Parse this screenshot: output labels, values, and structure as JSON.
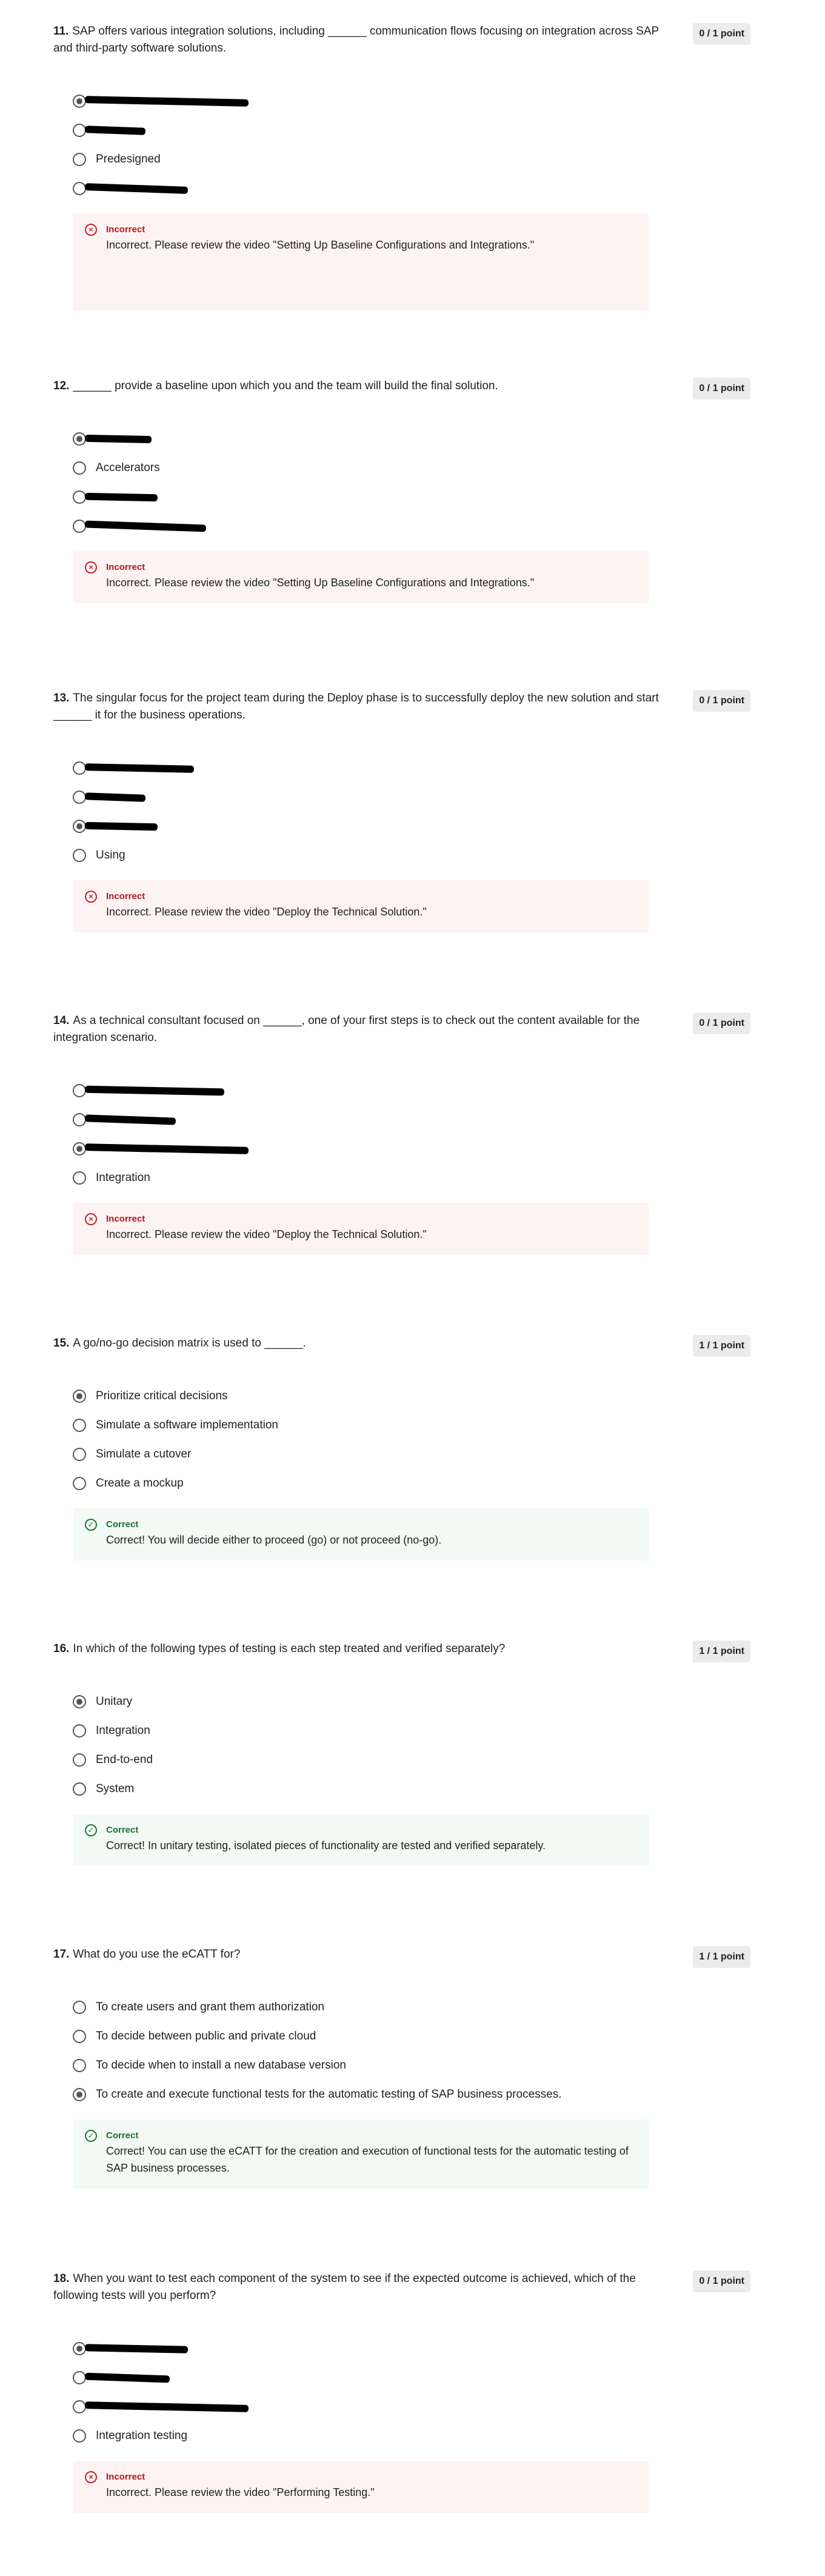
{
  "questions": [
    {
      "number": "11.",
      "text": "SAP offers various integration solutions, including ______ communication flows focusing on integration across SAP and third-party software solutions.",
      "points": "0 / 1 point",
      "options": [
        {
          "label": "",
          "selected": true,
          "redacted": 270
        },
        {
          "label": "",
          "selected": false,
          "redacted": 100
        },
        {
          "label": "Predesigned",
          "selected": false,
          "redacted": 0
        },
        {
          "label": "",
          "selected": false,
          "redacted": 170
        }
      ],
      "feedback": {
        "status": "incorrect",
        "title": "Incorrect",
        "icon": "close-icon",
        "text": "Incorrect. Please review the video \"Setting Up Baseline Configurations and Integrations.\""
      }
    },
    {
      "number": "12.",
      "text": "______ provide a baseline upon which you and the team will build the final solution.",
      "points": "0 / 1 point",
      "options": [
        {
          "label": "",
          "selected": true,
          "redacted": 110
        },
        {
          "label": "Accelerators",
          "selected": false,
          "redacted": 0
        },
        {
          "label": "",
          "selected": false,
          "redacted": 120
        },
        {
          "label": "",
          "selected": false,
          "redacted": 200
        }
      ],
      "feedback": {
        "status": "incorrect",
        "title": "Incorrect",
        "icon": "close-icon",
        "text": "Incorrect. Please review the video \"Setting Up Baseline Configurations and Integrations.\""
      }
    },
    {
      "number": "13.",
      "text": "The singular focus for the project team during the Deploy phase is to successfully deploy the new solution and start ______ it for the business operations.",
      "points": "0 / 1 point",
      "options": [
        {
          "label": "",
          "selected": false,
          "redacted": 180
        },
        {
          "label": "",
          "selected": false,
          "redacted": 100
        },
        {
          "label": "",
          "selected": true,
          "redacted": 120
        },
        {
          "label": "Using",
          "selected": false,
          "redacted": 0
        }
      ],
      "feedback": {
        "status": "incorrect",
        "title": "Incorrect",
        "icon": "close-icon",
        "text": "Incorrect. Please review the video \"Deploy the Technical Solution.\""
      }
    },
    {
      "number": "14.",
      "text": "As a technical consultant focused on ______, one of your first steps is to check out the content available for the integration scenario.",
      "points": "0 / 1 point",
      "options": [
        {
          "label": "",
          "selected": false,
          "redacted": 230
        },
        {
          "label": "",
          "selected": false,
          "redacted": 150
        },
        {
          "label": "",
          "selected": true,
          "redacted": 270
        },
        {
          "label": "Integration",
          "selected": false,
          "redacted": 0
        }
      ],
      "feedback": {
        "status": "incorrect",
        "title": "Incorrect",
        "icon": "close-icon",
        "text": "Incorrect. Please review the video \"Deploy the Technical Solution.\""
      }
    },
    {
      "number": "15.",
      "text": "A go/no-go decision matrix is used to ______.",
      "points": "1 / 1 point",
      "options": [
        {
          "label": "Prioritize critical decisions",
          "selected": true,
          "redacted": 0
        },
        {
          "label": "Simulate a software implementation",
          "selected": false,
          "redacted": 0
        },
        {
          "label": "Simulate a cutover",
          "selected": false,
          "redacted": 0
        },
        {
          "label": "Create a mockup",
          "selected": false,
          "redacted": 0
        }
      ],
      "feedback": {
        "status": "correct",
        "title": "Correct",
        "icon": "check-icon",
        "text": "Correct! You will decide either to proceed (go) or not proceed (no-go)."
      }
    },
    {
      "number": "16.",
      "text": "In which of the following types of testing is each step treated and verified separately?",
      "points": "1 / 1 point",
      "options": [
        {
          "label": "Unitary",
          "selected": true,
          "redacted": 0
        },
        {
          "label": "Integration",
          "selected": false,
          "redacted": 0
        },
        {
          "label": "End-to-end",
          "selected": false,
          "redacted": 0
        },
        {
          "label": "System",
          "selected": false,
          "redacted": 0
        }
      ],
      "feedback": {
        "status": "correct",
        "title": "Correct",
        "icon": "check-icon",
        "text": "Correct! In unitary testing, isolated pieces of functionality are tested and verified separately."
      }
    },
    {
      "number": "17.",
      "text": "What do you use the eCATT for?",
      "points": "1 / 1 point",
      "options": [
        {
          "label": "To create users and grant them authorization",
          "selected": false,
          "redacted": 0
        },
        {
          "label": "To decide between public and private cloud",
          "selected": false,
          "redacted": 0
        },
        {
          "label": "To decide when to install a new database version",
          "selected": false,
          "redacted": 0
        },
        {
          "label": "To create and execute functional tests for the automatic testing of SAP business processes.",
          "selected": true,
          "redacted": 0
        }
      ],
      "feedback": {
        "status": "correct",
        "title": "Correct",
        "icon": "check-icon",
        "text": "Correct! You can use the eCATT for the creation and execution of functional tests for the automatic testing of SAP business processes."
      }
    },
    {
      "number": "18.",
      "text": "When you want to test each component of the system to see if the expected outcome is achieved, which of the following tests will you perform?",
      "points": "0 / 1 point",
      "options": [
        {
          "label": "",
          "selected": true,
          "redacted": 170
        },
        {
          "label": "",
          "selected": false,
          "redacted": 140
        },
        {
          "label": "",
          "selected": false,
          "redacted": 270
        },
        {
          "label": "Integration testing",
          "selected": false,
          "redacted": 0
        }
      ],
      "feedback": {
        "status": "incorrect",
        "title": "Incorrect",
        "icon": "close-icon",
        "text": "Incorrect. Please review the video \"Performing Testing.\""
      }
    }
  ]
}
